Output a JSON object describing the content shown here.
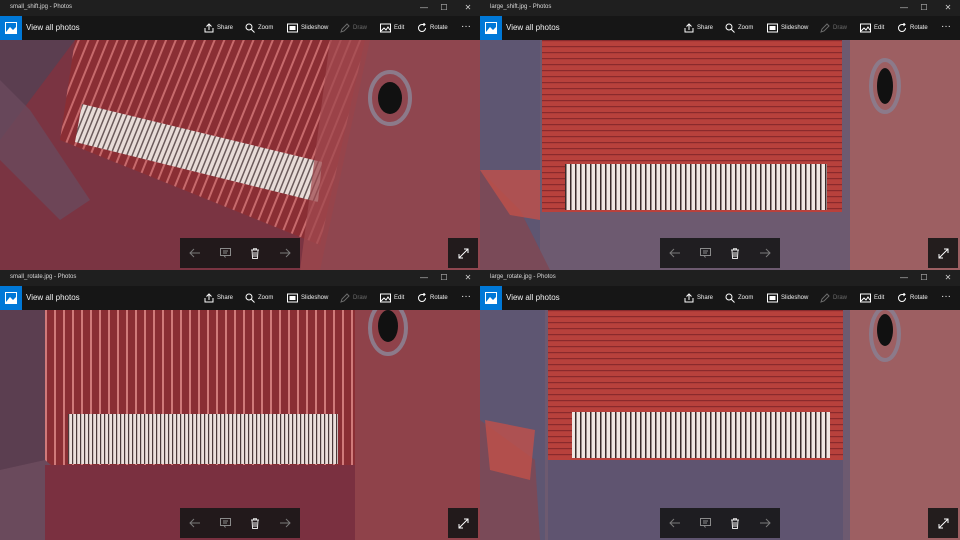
{
  "colors": {
    "accent": "#0078d7",
    "toolbar_bg": "#161616",
    "titlebar_bg": "#1f1f1f",
    "disabled_text": "#6c6c6c"
  },
  "windows": [
    {
      "title": "small_shift.jpg - Photos"
    },
    {
      "title": "large_shift.jpg - Photos"
    },
    {
      "title": "small_rotate.jpg - Photos"
    },
    {
      "title": "large_rotate.jpg - Photos"
    }
  ],
  "toolbar": {
    "view_all": "View all photos",
    "share": "Share",
    "zoom": "Zoom",
    "slideshow": "Slideshow",
    "draw": "Draw",
    "edit": "Edit",
    "rotate": "Rotate",
    "more": "···"
  },
  "icons": {
    "app": "photos-app-icon",
    "share": "share-icon",
    "zoom": "zoom-icon",
    "slideshow": "slideshow-icon",
    "draw": "draw-icon",
    "edit": "edit-icon",
    "rotate": "rotate-icon",
    "prev": "arrow-left-icon",
    "info": "info-icon",
    "delete": "trash-icon",
    "next": "arrow-right-icon",
    "fullscreen": "expand-icon"
  },
  "window_controls": {
    "minimize": "—",
    "maximize": "☐",
    "close": "✕"
  }
}
